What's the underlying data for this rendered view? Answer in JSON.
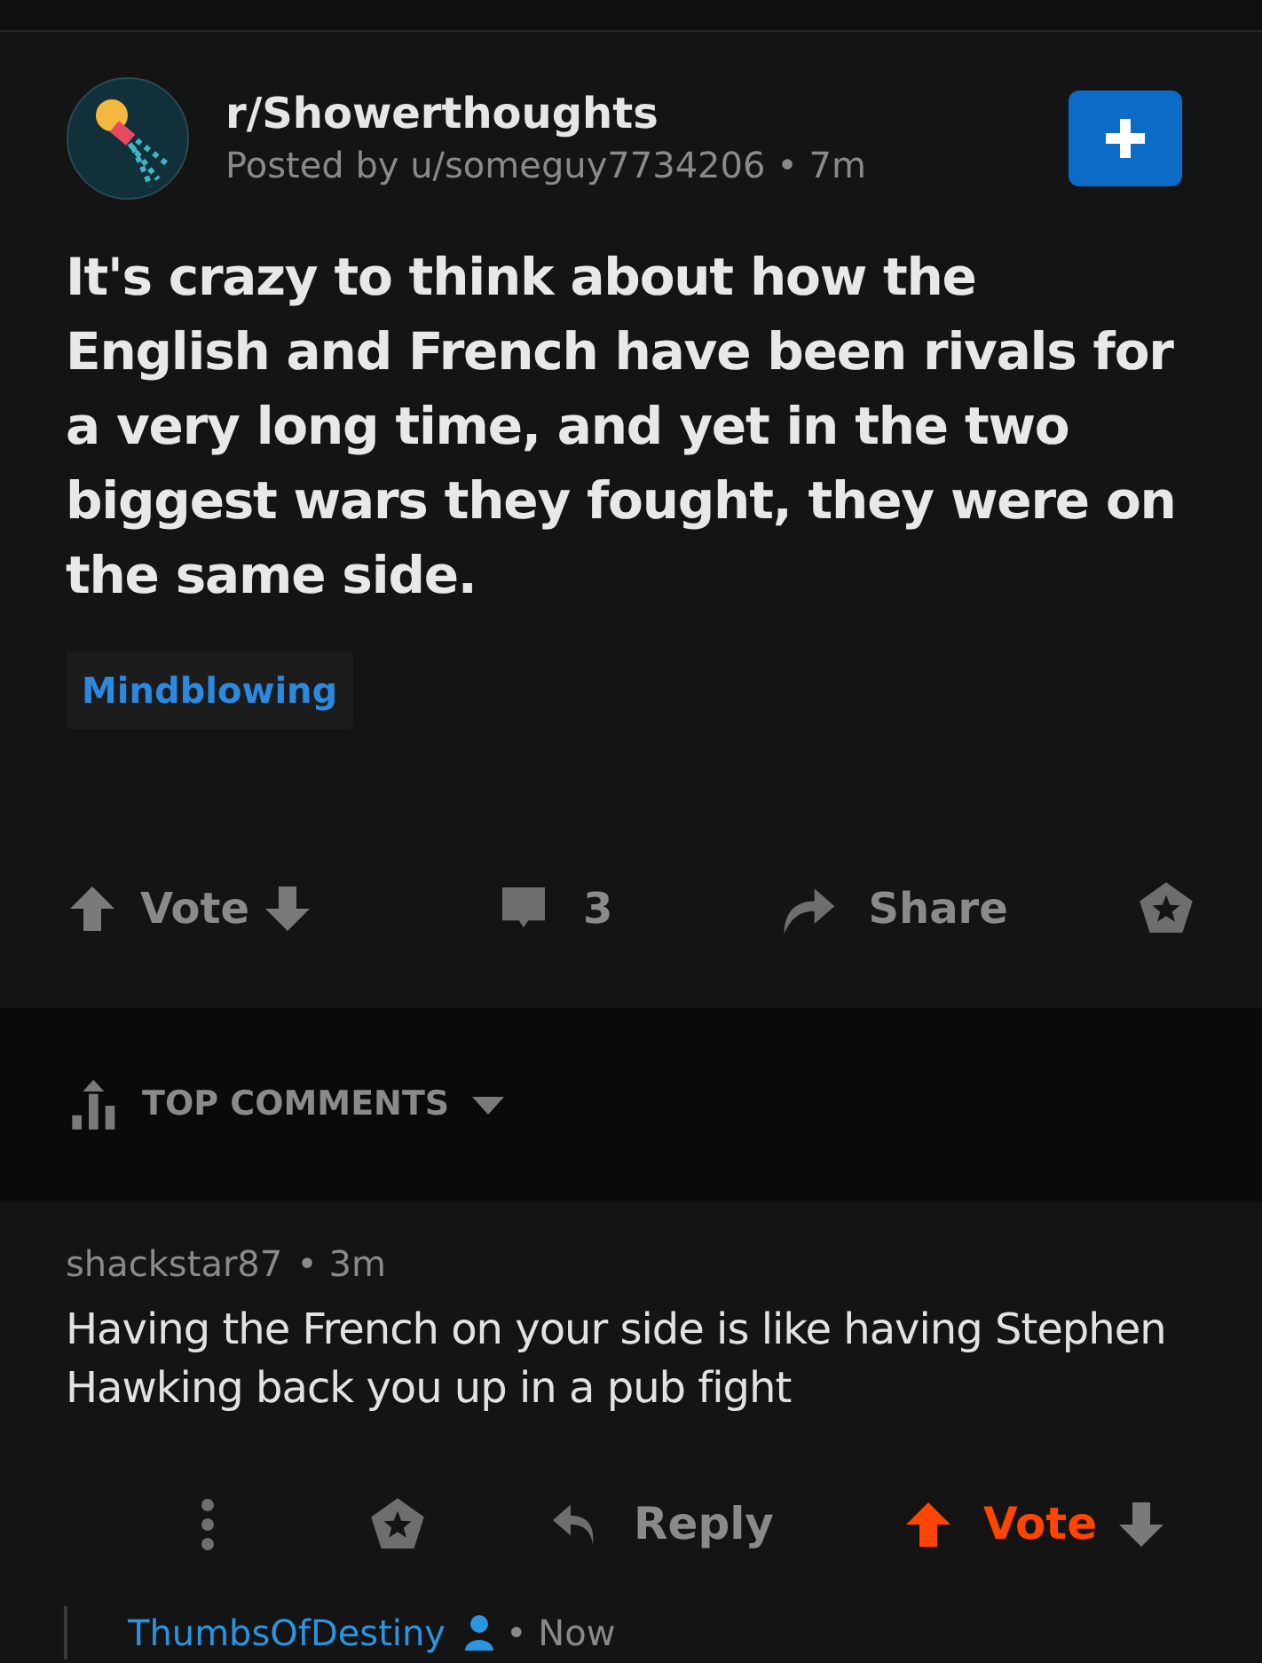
{
  "post": {
    "subreddit": "r/Showerthoughts",
    "meta": "Posted by u/someguy7734206 • 7m",
    "title": "It's crazy to think about how the English and French have been rivals for a very long time, and yet in the two biggest wars they fought, they were on the same side.",
    "flair": "Mindblowing",
    "vote": {
      "label": "Vote",
      "upvoted": false
    },
    "comments_count": "3",
    "share": "Share"
  },
  "sort": {
    "label": "TOP COMMENTS"
  },
  "comments": [
    {
      "author": "shackstar87",
      "time": "• 3m",
      "body": "Having the French on your side is like having Stephen Hawking back you up in a pub fight",
      "reply": "Reply",
      "vote": {
        "label": "Vote",
        "upvoted": true
      }
    }
  ],
  "reply_preview": {
    "author": "ThumbsOfDestiny",
    "time": "• Now"
  }
}
